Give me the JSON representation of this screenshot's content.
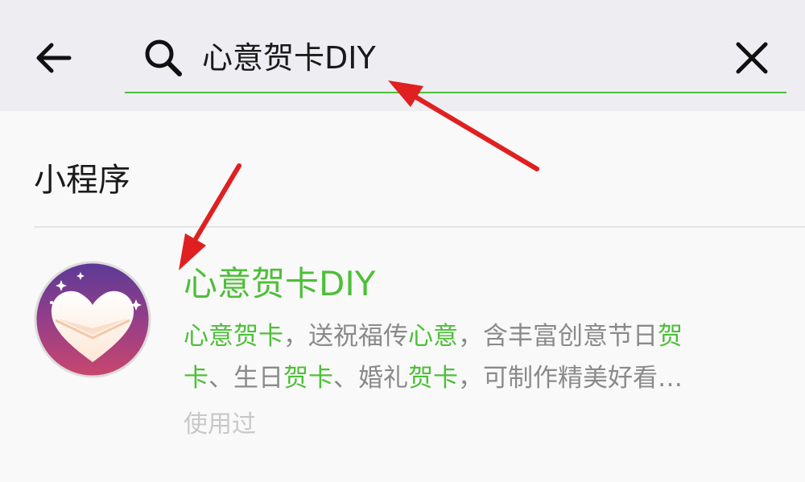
{
  "header": {
    "back_icon": "arrow-left-icon",
    "search_icon": "search-icon",
    "search_value": "心意贺卡DIY",
    "clear_icon": "close-icon",
    "accent_color": "#4dbf38"
  },
  "section": {
    "title": "小程序"
  },
  "result": {
    "name": "心意贺卡DIY",
    "desc_line1": [
      {
        "text": "心意贺卡",
        "hl": true
      },
      {
        "text": "，送祝福传",
        "hl": false
      },
      {
        "text": "心意",
        "hl": true
      },
      {
        "text": "，含丰富创意节日",
        "hl": false
      },
      {
        "text": "贺",
        "hl": true
      }
    ],
    "desc_line2": [
      {
        "text": "卡",
        "hl": true
      },
      {
        "text": "、生日",
        "hl": false
      },
      {
        "text": "贺卡",
        "hl": true
      },
      {
        "text": "、婚礼",
        "hl": false
      },
      {
        "text": "贺卡",
        "hl": true
      },
      {
        "text": "，可制作精美好看…",
        "hl": false
      }
    ],
    "meta": "使用过",
    "avatar_icon": "heart-envelope-icon"
  },
  "annotations": {
    "arrow_color": "#e02020"
  }
}
